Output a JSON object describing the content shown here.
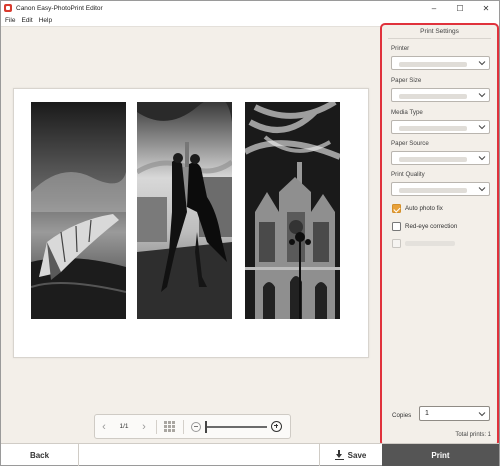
{
  "window": {
    "title": "Canon Easy-PhotoPrint Editor",
    "controls": [
      "minimize-icon",
      "maximize-icon",
      "close-icon"
    ]
  },
  "menu": [
    "File",
    "Edit",
    "Help"
  ],
  "preview": {
    "photos": [
      "old wooden boat",
      "tango dancers",
      "cathedral"
    ],
    "page_indicator": "1/1"
  },
  "settings": {
    "title": "Print Settings",
    "fields": [
      {
        "label": "Printer",
        "value": ""
      },
      {
        "label": "Paper Size",
        "value": ""
      },
      {
        "label": "Media Type",
        "value": ""
      },
      {
        "label": "Paper Source",
        "value": ""
      },
      {
        "label": "Print Quality",
        "value": ""
      }
    ],
    "checkboxes": [
      {
        "label": "Auto photo fix",
        "checked": true,
        "disabled": false
      },
      {
        "label": "Red-eye correction",
        "checked": false,
        "disabled": false
      },
      {
        "label": "",
        "checked": false,
        "disabled": true
      }
    ],
    "copies_label": "Copies",
    "copies_value": "1",
    "total_prints": "Total prints: 1",
    "highlight_color": "#e0323c",
    "checkbox_color": "#e8a13a"
  },
  "bottom": {
    "back_label": "Back",
    "save_label": "Save",
    "print_label": "Print"
  },
  "zoom": {
    "level": 0.0
  }
}
